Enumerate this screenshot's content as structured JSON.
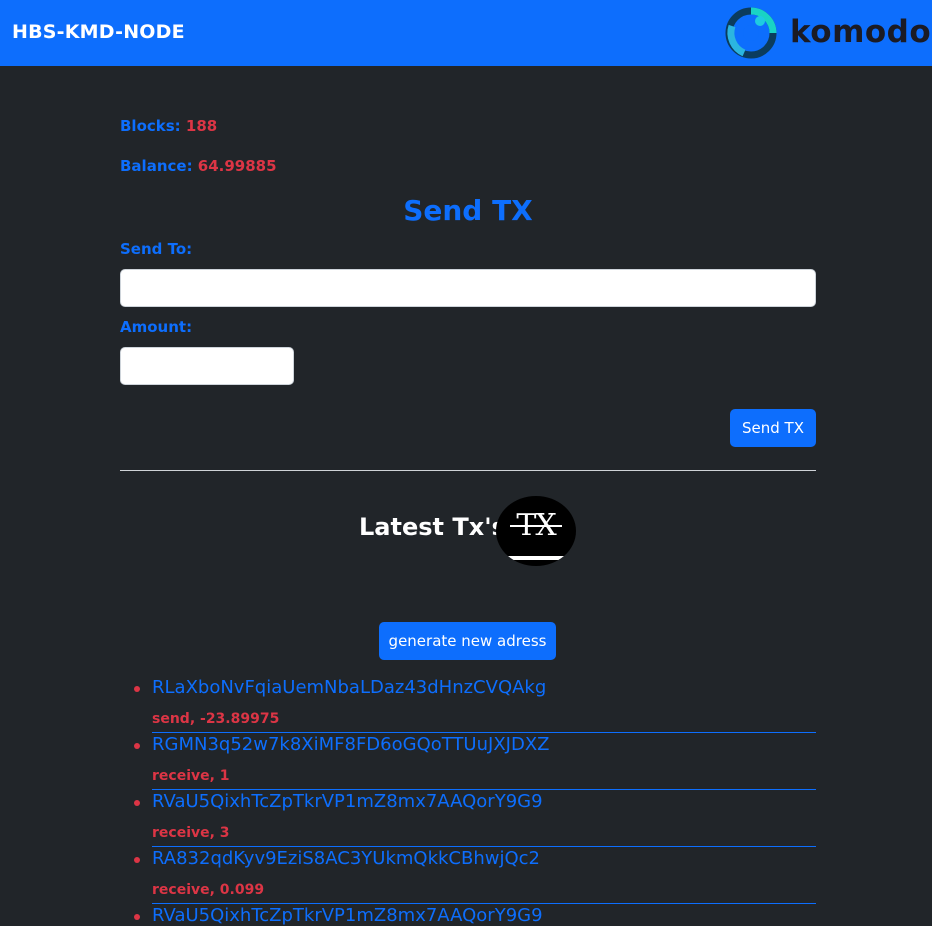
{
  "navbar": {
    "brand": "HBS-KMD-NODE",
    "logo_text": "komodo"
  },
  "stats": {
    "blocks_label": "Blocks:",
    "blocks_value": "188",
    "balance_label": "Balance:",
    "balance_value": "64.99885"
  },
  "send_form": {
    "title": "Send TX",
    "send_to_label": "Send To:",
    "send_to_value": "",
    "amount_label": "Amount:",
    "amount_value": "",
    "submit_label": "Send TX"
  },
  "latest": {
    "title": "Latest Tx's",
    "logo_text": "TX",
    "generate_label": "generate new adress"
  },
  "transactions": [
    {
      "address": "RLaXboNvFqiaUemNbaLDaz43dHnzCVQAkg",
      "meta": "send, -23.89975"
    },
    {
      "address": "RGMN3q52w7k8XiMF8FD6oGQoTTUuJXJDXZ",
      "meta": "receive, 1"
    },
    {
      "address": "RVaU5QixhTcZpTkrVP1mZ8mx7AAQorY9G9",
      "meta": "receive, 3"
    },
    {
      "address": "RA832qdKyv9EziS8AC3YUkmQkkCBhwjQc2",
      "meta": "receive, 0.099"
    },
    {
      "address": "RVaU5QixhTcZpTkrVP1mZ8mx7AAQorY9G9",
      "meta": ""
    }
  ],
  "colors": {
    "primary": "#0d6efd",
    "danger": "#dc3545",
    "background": "#212529"
  }
}
